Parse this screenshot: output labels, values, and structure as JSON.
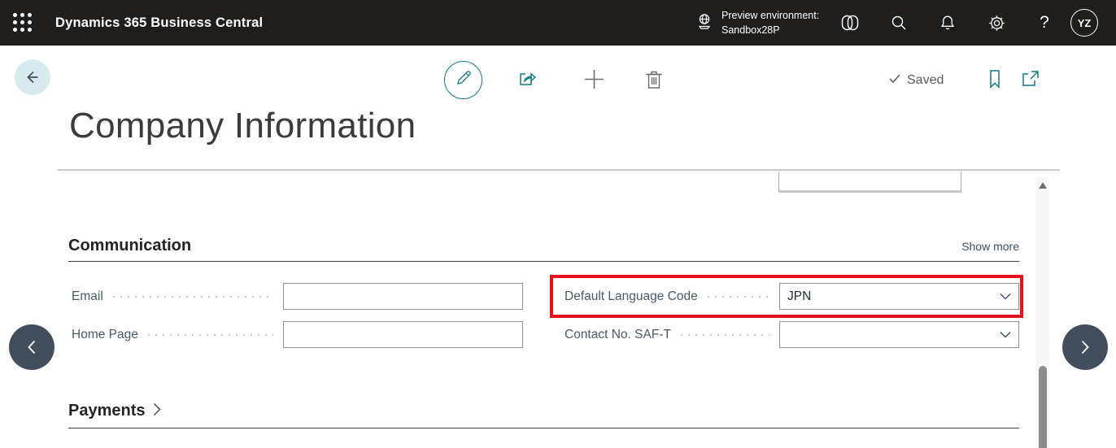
{
  "topbar": {
    "product": "Dynamics 365 Business Central",
    "environment": {
      "line1": "Preview environment:",
      "line2": "Sandbox28P"
    },
    "help": "?",
    "avatar_initials": "YZ"
  },
  "toolbar": {
    "saved_label": "Saved"
  },
  "page": {
    "title": "Company Information"
  },
  "communication": {
    "heading": "Communication",
    "show_more": "Show more",
    "fields": [
      {
        "label": "Email",
        "value": ""
      },
      {
        "label": "Home Page",
        "value": ""
      },
      {
        "label": "Default Language Code",
        "value": "JPN"
      },
      {
        "label": "Contact No. SAF-T",
        "value": ""
      }
    ]
  },
  "payments": {
    "heading": "Payments"
  },
  "icons": {
    "app-launcher": "waffle-grid",
    "environment": "globe-on-stand",
    "copilot": "double-pill",
    "search": "magnifier",
    "notifications": "bell",
    "settings": "gear",
    "back": "arrow-left",
    "edit": "pencil-in-circle",
    "share": "arrow-out-of-tray",
    "add": "plus",
    "delete": "trash",
    "saved": "checkmark",
    "bookmark": "bookmark-outline",
    "open-in-new": "box-arrow-up-right",
    "combo": "chevron-down",
    "section-collapsed": "chevron-right",
    "page-nav": "chevron-left / chevron-right"
  },
  "colors": {
    "topbar_bg": "#1f1e1d",
    "accent_teal": "#0f7b83",
    "highlight_red": "#e6111b",
    "nav_circle": "#424e5c",
    "back_circle": "#d7ebee"
  }
}
